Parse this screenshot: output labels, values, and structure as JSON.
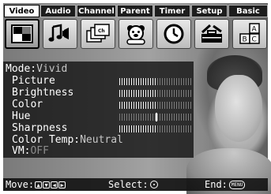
{
  "tabs": [
    {
      "label": "Video",
      "active": true
    },
    {
      "label": "Audio",
      "active": false
    },
    {
      "label": "Channel",
      "active": false
    },
    {
      "label": "Parent",
      "active": false
    },
    {
      "label": "Timer",
      "active": false
    },
    {
      "label": "Setup",
      "active": false
    },
    {
      "label": "Basic",
      "active": false
    }
  ],
  "icons": [
    "video-picture-icon",
    "audio-notes-icon",
    "channel-screens-icon",
    "parent-bear-icon",
    "timer-clock-icon",
    "setup-toolbox-icon",
    "basic-blocks-icon"
  ],
  "panel": {
    "mode_label": "Mode:",
    "mode_value": "Vivid",
    "picture_label": "Picture",
    "brightness_label": "Brightness",
    "color_label": "Color",
    "hue_label": "Hue",
    "sharpness_label": "Sharpness",
    "color_temp_label": "Color Temp:",
    "color_temp_value": "Neutral",
    "vm_label": "VM:",
    "vm_value": "OFF"
  },
  "levels": {
    "picture": 0.52,
    "brightness": 0.52,
    "color": 0.52,
    "hue": 0.5,
    "sharpness": 0.52
  },
  "bottom": {
    "move_label": "Move:",
    "select_label": "Select:",
    "end_label": "End:",
    "menu_key_label": "MENU"
  }
}
